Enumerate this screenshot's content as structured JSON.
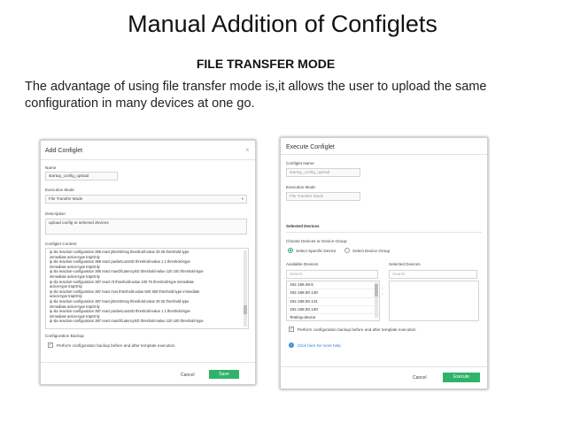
{
  "slide": {
    "title": "Manual Addition of Configlets",
    "subtitle": "FILE TRANSFER MODE",
    "description": "The advantage of using file transfer mode is,it allows the user to upload the same configuration in many devices at one go."
  },
  "add_configlet": {
    "header": "Add Configlet",
    "close": "×",
    "name_label": "Name",
    "name_value": "startup_config_upload",
    "execution_mode_label": "Execution Mode",
    "execution_mode_value": "File Transfer Mode",
    "description_label": "Description",
    "description_value": "upload config to selected devices",
    "content_label": "Configlet Content",
    "content_lines": [
      "ip sla reaction-configuration 385 react jitterSDAvg threshold-value 30 25 threshold-type",
      "immediate action-type trapOnly",
      "ip sla reaction-configuration 386 react packetLossSD threshold-value 1 1 threshold-type",
      "immediate action-type trapOnly",
      "ip sla reaction-configuration 386 react maxOfLatencySD threshold-value 120 100 threshold-type",
      "immediate action-type trapOnly",
      "ip sla reaction-configuration 387 react rtt threshold-value 100 75 threshold-type immediate",
      "action-type trapOnly",
      "ip sla reaction-configuration 387 react mos threshold-value 500 350 threshold-type immediate",
      "action-type trapOnly",
      "ip sla reaction-configuration 387 react jitterSDAvg threshold-value 30 25 threshold-type",
      "immediate action-type trapOnly",
      "ip sla reaction-configuration 387 react packetLossSD threshold-value 1 1 threshold-type",
      "immediate action-type trapOnly",
      "ip sla reaction-configuration 387 react maxOfLatencySD threshold-value 120 100 threshold-type"
    ],
    "backup_label": "Configuration Backup",
    "backup_option": "Perform configuration backup before and after template execution",
    "cancel": "Cancel",
    "save": "Save"
  },
  "execute_configlet": {
    "header": "Execute Configlet",
    "name_label": "Configlet Name",
    "name_value": "startup_config_upload",
    "execution_mode_label": "Execution Mode",
    "execution_mode_value": "File Transfer Mode",
    "selected_devices_heading": "Selected Devices",
    "choose_label": "Choose Devices or Device Group:",
    "radio_specific": "Select Specific Device",
    "radio_group": "Select Device Group",
    "available_label": "Available Devices",
    "selected_label": "Selected Devices",
    "search_placeholder": "Search",
    "devices": [
      "192.168.49.6",
      "192.168.50.130",
      "192.168.50.131",
      "192.168.50.140",
      "Testing-device"
    ],
    "backup_option": "Perform configuration backup before and after template execution",
    "more_help": "Click here for more help",
    "cancel": "Cancel",
    "execute": "Execute"
  },
  "colors": {
    "accent_green": "#2fb36a",
    "info_blue": "#3a8fd8"
  }
}
